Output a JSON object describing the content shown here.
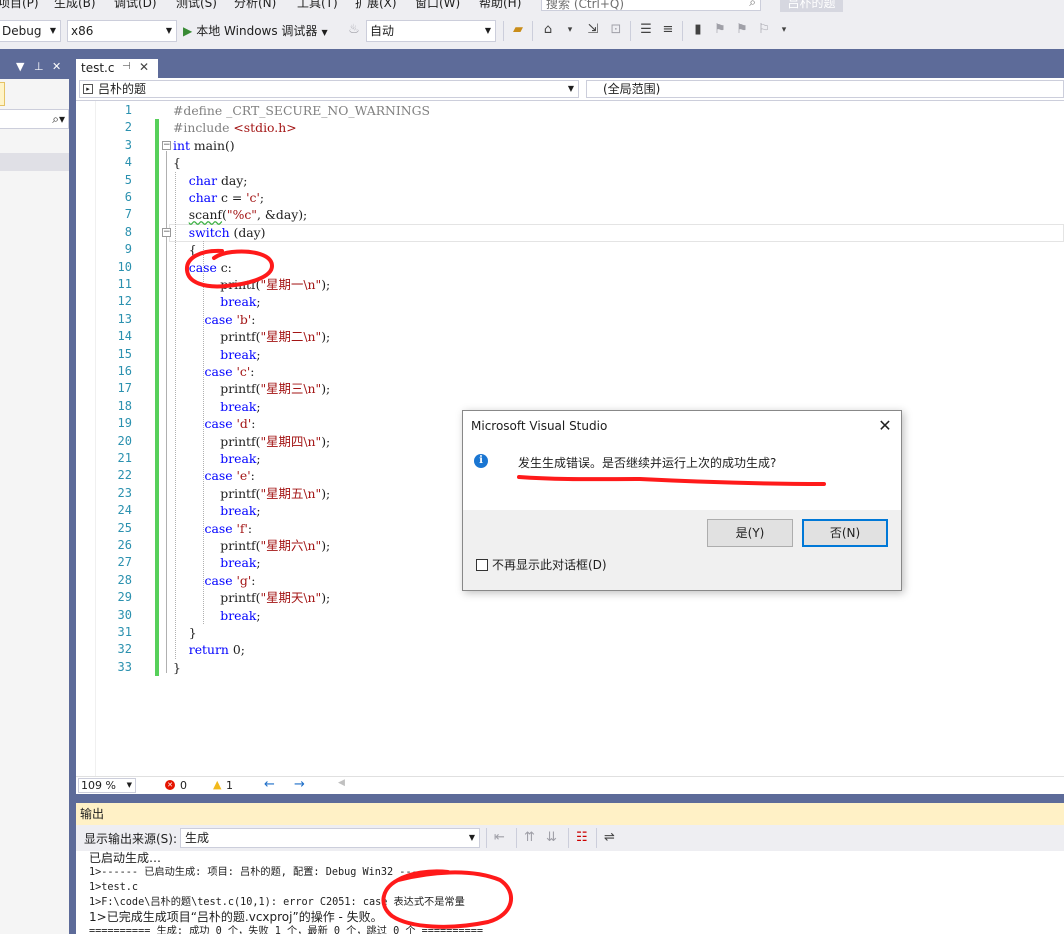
{
  "menubar": {
    "items": [
      "项目(P)",
      "生成(B)",
      "调试(D)",
      "测试(S)",
      "分析(N)",
      "工具(T)",
      "扩展(X)",
      "窗口(W)",
      "帮助(H)"
    ],
    "search_placeholder": "搜索 (Ctrl+Q)",
    "project_title": "吕朴的题"
  },
  "toolbar": {
    "config": "Debug",
    "platform": "x86",
    "run_label": "本地 Windows 调试器",
    "auto_label": "自动"
  },
  "editor": {
    "tab_name": "test.c",
    "nav_left": "吕朴的题",
    "nav_right": "(全局范围)",
    "line_numbers": [
      "1",
      "2",
      "3",
      "4",
      "5",
      "6",
      "7",
      "8",
      "9",
      "10",
      "11",
      "12",
      "13",
      "14",
      "15",
      "16",
      "17",
      "18",
      "19",
      "20",
      "21",
      "22",
      "23",
      "24",
      "25",
      "26",
      "27",
      "28",
      "29",
      "30",
      "31",
      "32",
      "33"
    ],
    "lines": [
      [
        {
          "t": "#define _CRT_SECURE_NO_WARNINGS",
          "c": "pp"
        }
      ],
      [
        {
          "t": "#include ",
          "c": "pp"
        },
        {
          "t": "<stdio.h>",
          "c": "st"
        }
      ],
      [
        {
          "t": "int",
          "c": "kw"
        },
        {
          "t": " main()",
          "c": "tx"
        }
      ],
      [
        {
          "t": "{",
          "c": "tx"
        }
      ],
      [
        {
          "t": "    ",
          "c": "tx"
        },
        {
          "t": "char",
          "c": "kw"
        },
        {
          "t": " day;",
          "c": "tx"
        }
      ],
      [
        {
          "t": "    ",
          "c": "tx"
        },
        {
          "t": "char",
          "c": "kw"
        },
        {
          "t": " c = ",
          "c": "tx"
        },
        {
          "t": "'c'",
          "c": "st"
        },
        {
          "t": ";",
          "c": "tx"
        }
      ],
      [
        {
          "t": "    ",
          "c": "tx"
        },
        {
          "t": "scanf",
          "c": "tx sq"
        },
        {
          "t": "(",
          "c": "tx"
        },
        {
          "t": "\"%c\"",
          "c": "st"
        },
        {
          "t": ", &day);",
          "c": "tx"
        }
      ],
      [
        {
          "t": "    ",
          "c": "tx"
        },
        {
          "t": "switch",
          "c": "kw"
        },
        {
          "t": " (day)",
          "c": "tx"
        }
      ],
      [
        {
          "t": "    {",
          "c": "tx"
        }
      ],
      [
        {
          "t": "    ",
          "c": "tx"
        },
        {
          "t": "case",
          "c": "kw"
        },
        {
          "t": " c:",
          "c": "tx"
        }
      ],
      [
        {
          "t": "            printf(",
          "c": "tx"
        },
        {
          "t": "\"星期一\\n\"",
          "c": "st"
        },
        {
          "t": ");",
          "c": "tx"
        }
      ],
      [
        {
          "t": "            ",
          "c": "tx"
        },
        {
          "t": "break",
          "c": "kw"
        },
        {
          "t": ";",
          "c": "tx"
        }
      ],
      [
        {
          "t": "        ",
          "c": "tx"
        },
        {
          "t": "case",
          "c": "kw"
        },
        {
          "t": " ",
          "c": "tx"
        },
        {
          "t": "'b'",
          "c": "st"
        },
        {
          "t": ":",
          "c": "tx"
        }
      ],
      [
        {
          "t": "            printf(",
          "c": "tx"
        },
        {
          "t": "\"星期二\\n\"",
          "c": "st"
        },
        {
          "t": ");",
          "c": "tx"
        }
      ],
      [
        {
          "t": "            ",
          "c": "tx"
        },
        {
          "t": "break",
          "c": "kw"
        },
        {
          "t": ";",
          "c": "tx"
        }
      ],
      [
        {
          "t": "        ",
          "c": "tx"
        },
        {
          "t": "case",
          "c": "kw"
        },
        {
          "t": " ",
          "c": "tx"
        },
        {
          "t": "'c'",
          "c": "st"
        },
        {
          "t": ":",
          "c": "tx"
        }
      ],
      [
        {
          "t": "            printf(",
          "c": "tx"
        },
        {
          "t": "\"星期三\\n\"",
          "c": "st"
        },
        {
          "t": ");",
          "c": "tx"
        }
      ],
      [
        {
          "t": "            ",
          "c": "tx"
        },
        {
          "t": "break",
          "c": "kw"
        },
        {
          "t": ";",
          "c": "tx"
        }
      ],
      [
        {
          "t": "        ",
          "c": "tx"
        },
        {
          "t": "case",
          "c": "kw"
        },
        {
          "t": " ",
          "c": "tx"
        },
        {
          "t": "'d'",
          "c": "st"
        },
        {
          "t": ":",
          "c": "tx"
        }
      ],
      [
        {
          "t": "            printf(",
          "c": "tx"
        },
        {
          "t": "\"星期四\\n\"",
          "c": "st"
        },
        {
          "t": ");",
          "c": "tx"
        }
      ],
      [
        {
          "t": "            ",
          "c": "tx"
        },
        {
          "t": "break",
          "c": "kw"
        },
        {
          "t": ";",
          "c": "tx"
        }
      ],
      [
        {
          "t": "        ",
          "c": "tx"
        },
        {
          "t": "case",
          "c": "kw"
        },
        {
          "t": " ",
          "c": "tx"
        },
        {
          "t": "'e'",
          "c": "st"
        },
        {
          "t": ":",
          "c": "tx"
        }
      ],
      [
        {
          "t": "            printf(",
          "c": "tx"
        },
        {
          "t": "\"星期五\\n\"",
          "c": "st"
        },
        {
          "t": ");",
          "c": "tx"
        }
      ],
      [
        {
          "t": "            ",
          "c": "tx"
        },
        {
          "t": "break",
          "c": "kw"
        },
        {
          "t": ";",
          "c": "tx"
        }
      ],
      [
        {
          "t": "        ",
          "c": "tx"
        },
        {
          "t": "case",
          "c": "kw"
        },
        {
          "t": " ",
          "c": "tx"
        },
        {
          "t": "'f'",
          "c": "st"
        },
        {
          "t": ":",
          "c": "tx"
        }
      ],
      [
        {
          "t": "            printf(",
          "c": "tx"
        },
        {
          "t": "\"星期六\\n\"",
          "c": "st"
        },
        {
          "t": ");",
          "c": "tx"
        }
      ],
      [
        {
          "t": "            ",
          "c": "tx"
        },
        {
          "t": "break",
          "c": "kw"
        },
        {
          "t": ";",
          "c": "tx"
        }
      ],
      [
        {
          "t": "        ",
          "c": "tx"
        },
        {
          "t": "case",
          "c": "kw"
        },
        {
          "t": " ",
          "c": "tx"
        },
        {
          "t": "'g'",
          "c": "st"
        },
        {
          "t": ":",
          "c": "tx"
        }
      ],
      [
        {
          "t": "            printf(",
          "c": "tx"
        },
        {
          "t": "\"星期天\\n\"",
          "c": "st"
        },
        {
          "t": ");",
          "c": "tx"
        }
      ],
      [
        {
          "t": "            ",
          "c": "tx"
        },
        {
          "t": "break",
          "c": "kw"
        },
        {
          "t": ";",
          "c": "tx"
        }
      ],
      [
        {
          "t": "    }",
          "c": "tx"
        }
      ],
      [
        {
          "t": "    ",
          "c": "tx"
        },
        {
          "t": "return",
          "c": "kw"
        },
        {
          "t": " 0;",
          "c": "tx"
        }
      ],
      [
        {
          "t": "}",
          "c": "tx"
        }
      ]
    ]
  },
  "status": {
    "zoom": "109 %",
    "errors": "0",
    "warnings": "1"
  },
  "output": {
    "title": "输出",
    "source_label": "显示输出来源(S):",
    "source_value": "生成",
    "lines": [
      "已启动生成…",
      "1>------ 已启动生成: 项目: 吕朴的题, 配置: Debug Win32 ------",
      "1>test.c",
      "1>F:\\code\\吕朴的题\\test.c(10,1): error C2051: case 表达式不是常量",
      "1>已完成生成项目“吕朴的题.vcxproj”的操作 - 失败。",
      "========== 生成: 成功 0 个，失败 1 个，最新 0 个，跳过 0 个 =========="
    ]
  },
  "dialog": {
    "title": "Microsoft Visual Studio",
    "message": "发生生成错误。是否继续并运行上次的成功生成?",
    "yes_label": "是(Y)",
    "no_label": "否(N)",
    "checkbox_label": "不再显示此对话框(D)"
  },
  "colors": {
    "accent": "#5d6b99",
    "keyword": "#0000ff",
    "string": "#a31515",
    "preprocessor": "#808080",
    "line_number": "#2b91af",
    "annotation": "#ff1a1a"
  }
}
